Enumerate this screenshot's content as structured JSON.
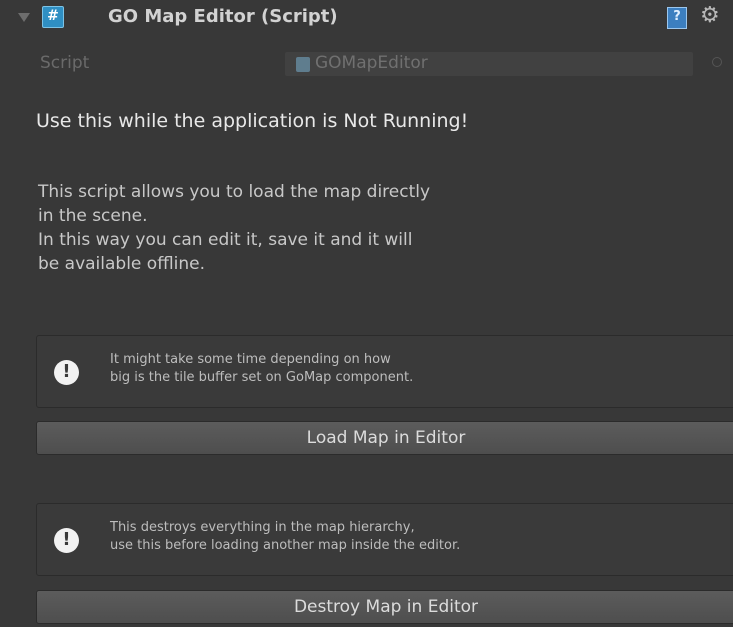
{
  "component": {
    "title": "GO Map Editor (Script)",
    "icons": [
      "script-icon",
      "help-icon",
      "gear-icon"
    ]
  },
  "script_field": {
    "label": "Script",
    "value": "GOMapEditor"
  },
  "warning_heading": "Use this while the application is Not Running!",
  "description_lines": [
    "This script allows you to load the map directly",
    "in the scene.",
    "In this way you can edit it, save it and it will",
    "be available offline."
  ],
  "load_section": {
    "help_lines": [
      "It might take some time depending on how",
      "big is the tile buffer set on GoMap component."
    ],
    "button_label": "Load Map in Editor"
  },
  "destroy_section": {
    "help_lines": [
      "This destroys everything in the map hierarchy,",
      "use this before loading another map inside the editor."
    ],
    "button_label": "Destroy Map in Editor"
  },
  "colors": {
    "background": "#383838",
    "script_icon": "#2f8fc3",
    "button": "#555555"
  }
}
